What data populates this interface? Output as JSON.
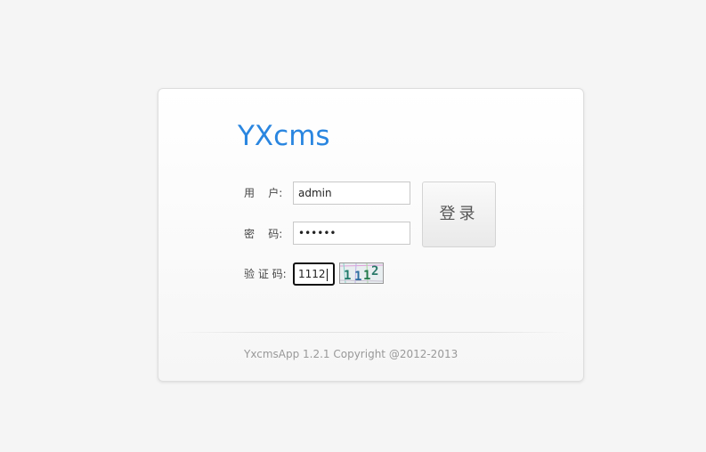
{
  "app": {
    "logo_text": "YXcms",
    "brand_color": "#2a86e0"
  },
  "form": {
    "username_label": "用    户:",
    "username_value": "admin",
    "password_label": "密    码:",
    "password_value": "••••••",
    "captcha_label": "验 证 码:",
    "captcha_value": "1112",
    "captcha_image_text": "1112",
    "login_button_label": "登录"
  },
  "footer": {
    "copyright": "YxcmsApp 1.2.1 Copyright @2012-2013"
  }
}
